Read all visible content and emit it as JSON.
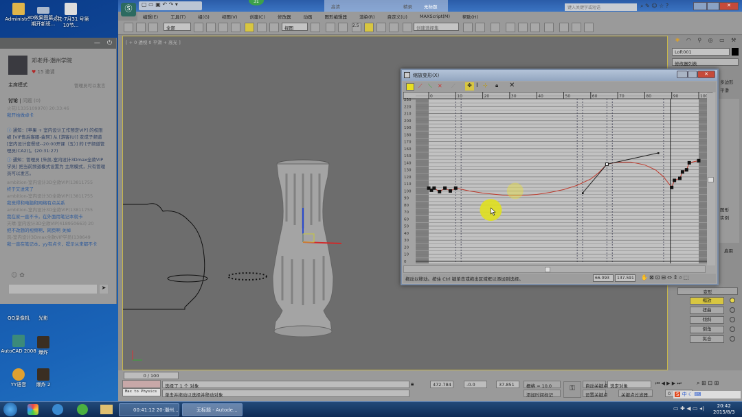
{
  "desktop": {
    "icons": [
      {
        "label": "Administr...",
        "icon": "folder-icon"
      },
      {
        "label": "3D效果图篇 七期开新班...",
        "icon": "screen-icon"
      },
      {
        "label": "火花-7月31 号第10节...",
        "icon": "video-file-icon"
      }
    ],
    "lower_icons": [
      {
        "label": "QQ录像机"
      },
      {
        "label": "光影"
      },
      {
        "label": "AutoCAD 2008"
      },
      {
        "label": "爆炸"
      },
      {
        "label": "YY语音"
      },
      {
        "label": "爆炸 2"
      }
    ]
  },
  "chat": {
    "user": "邓老师-潮州学院",
    "likes": "15",
    "invite": "邀请",
    "mode": "主席模式",
    "mode_note": "管理员可以发言",
    "tab_discuss": "讨论",
    "tab_question": "问题 (0)",
    "messages": [
      {
        "who": "火花(1335109970) 20:33:46",
        "text": "我开始做卓卡"
      },
      {
        "notice": "通知：[苹果 + 室内设计工作预定VIP] 的权限被 [VIP售后客服-金珂] 从 [游客(U)] 变成子频道 [室内设计套餐班--20:00开课（五）] 的 [子频道管理员(CA2)]。(20:31:27)"
      },
      {
        "notice": "通知：管理员 [朱凯-室内设计3Dmax全款VIP学员] 把当前频道模式设置为 主席模式，只有管理员可以发言。"
      },
      {
        "who": "ambition-室内设计3D全款VIP(13811755",
        "text": "终于又进来了"
      },
      {
        "who": "ambition-室内设计3D全款VIP(13811755",
        "text": "我觉得和电脑和网络有点关系"
      },
      {
        "who": "ambition-室内设计3D全款VIP(13811755",
        "text": "我在家一直不卡，在外面用笔记本就卡"
      },
      {
        "who": "天晴-室内设计3D全款VIP(418950663) 20",
        "text": "把不改题的视频啊，网页啊 关掉"
      },
      {
        "who": "风-室内设计3Dmax全款VIP学员(138649",
        "text": "我一直在笔记本，yy有点卡，提示从来都不卡"
      }
    ]
  },
  "max": {
    "badge": "31",
    "title_right": [
      "高清",
      "精录",
      "无标题"
    ],
    "search_placeholder": "键入关键字或短语",
    "menu": [
      "编辑(E)",
      "工具(T)",
      "组(G)",
      "视图(V)",
      "创建(C)",
      "修改器",
      "动画",
      "图形编辑器",
      "渲染(R)",
      "自定义(U)",
      "MAXScript(M)",
      "帮助(H)"
    ],
    "toolbar": {
      "filter": "全部",
      "ref_coord": "视图",
      "snap": "2.5",
      "selection_set": "创建选择集"
    },
    "viewport_label": "[ + 0 透视 0 平滑 + 高光 ]",
    "command_panel": {
      "object_name": "Loft001",
      "modifier_list": "修改器列表",
      "frag1": "多边形",
      "frag2": "平滑",
      "frag3": "图形",
      "frag4": "实例",
      "frag5": "启用",
      "rollout": "变形",
      "deform_buttons": [
        {
          "label": "缩放",
          "active": true
        },
        {
          "label": "扭曲",
          "active": false
        },
        {
          "label": "倾斜",
          "active": false
        },
        {
          "label": "倒角",
          "active": false
        },
        {
          "label": "拟合",
          "active": false
        }
      ]
    },
    "timeline": "0 / 100",
    "status": {
      "script": "Max to Physics",
      "selected": "选择了 1 个 对象",
      "prompt": "单击并拖动以选择并移动对象",
      "x": "472.784",
      "y": "-0.0",
      "z": "37.851",
      "grid": "栅格 = 10.0",
      "add_time_tag": "添加时间标记",
      "auto_key": "自动关键点",
      "set_key": "设置关键点",
      "key_mode": "选定对象",
      "key_filters": "关键点过滤器...",
      "frame": "0"
    },
    "ime": [
      "中"
    ]
  },
  "scale_dialog": {
    "title": "缩放变形(X)",
    "status_text": "拖动以移动。按住 Ctrl 键单击或拖出区域框以添加到选择。",
    "x_value": "66.093",
    "y_value": "137.591",
    "x_ticks": [
      0,
      10,
      20,
      30,
      40,
      50,
      60,
      70,
      80,
      90,
      100
    ],
    "y_ticks": [
      230,
      220,
      210,
      200,
      190,
      180,
      170,
      160,
      150,
      140,
      130,
      120,
      110,
      100,
      90,
      80,
      70,
      60,
      50,
      40,
      30,
      20,
      10,
      0
    ],
    "control_points": [
      [
        0,
        104
      ],
      [
        1,
        101
      ],
      [
        2,
        104
      ],
      [
        4,
        99
      ],
      [
        6,
        104
      ],
      [
        8,
        100
      ],
      [
        10,
        104
      ],
      [
        66,
        138
      ],
      [
        90,
        105
      ],
      [
        91,
        115
      ],
      [
        93,
        118
      ],
      [
        94,
        127
      ],
      [
        95.5,
        130
      ],
      [
        96.5,
        140
      ],
      [
        100,
        143
      ]
    ],
    "curve": [
      [
        10,
        104
      ],
      [
        15,
        100
      ],
      [
        20,
        97
      ],
      [
        25,
        95
      ],
      [
        30,
        93
      ],
      [
        35,
        93.5
      ],
      [
        40,
        95
      ],
      [
        45,
        98
      ],
      [
        50,
        102
      ],
      [
        55,
        108
      ],
      [
        60,
        117
      ],
      [
        63,
        126
      ],
      [
        66,
        138
      ],
      [
        70,
        141
      ],
      [
        75,
        141
      ],
      [
        80,
        137
      ],
      [
        84,
        130
      ],
      [
        87,
        120
      ],
      [
        90,
        105
      ]
    ],
    "bezier_handles": [
      [
        57,
        97
      ],
      [
        66,
        138
      ],
      [
        85,
        154
      ]
    ],
    "dashed_markers": [
      10,
      12,
      55,
      57,
      66,
      68,
      87
    ],
    "current_marker": 89.5,
    "curve_color": "#c0392b"
  },
  "taskbar": {
    "tasks": [
      "00:41:12  20-潮州...",
      "无标题 - Autode..."
    ],
    "time": "20:42",
    "date": "2015/8/3"
  }
}
